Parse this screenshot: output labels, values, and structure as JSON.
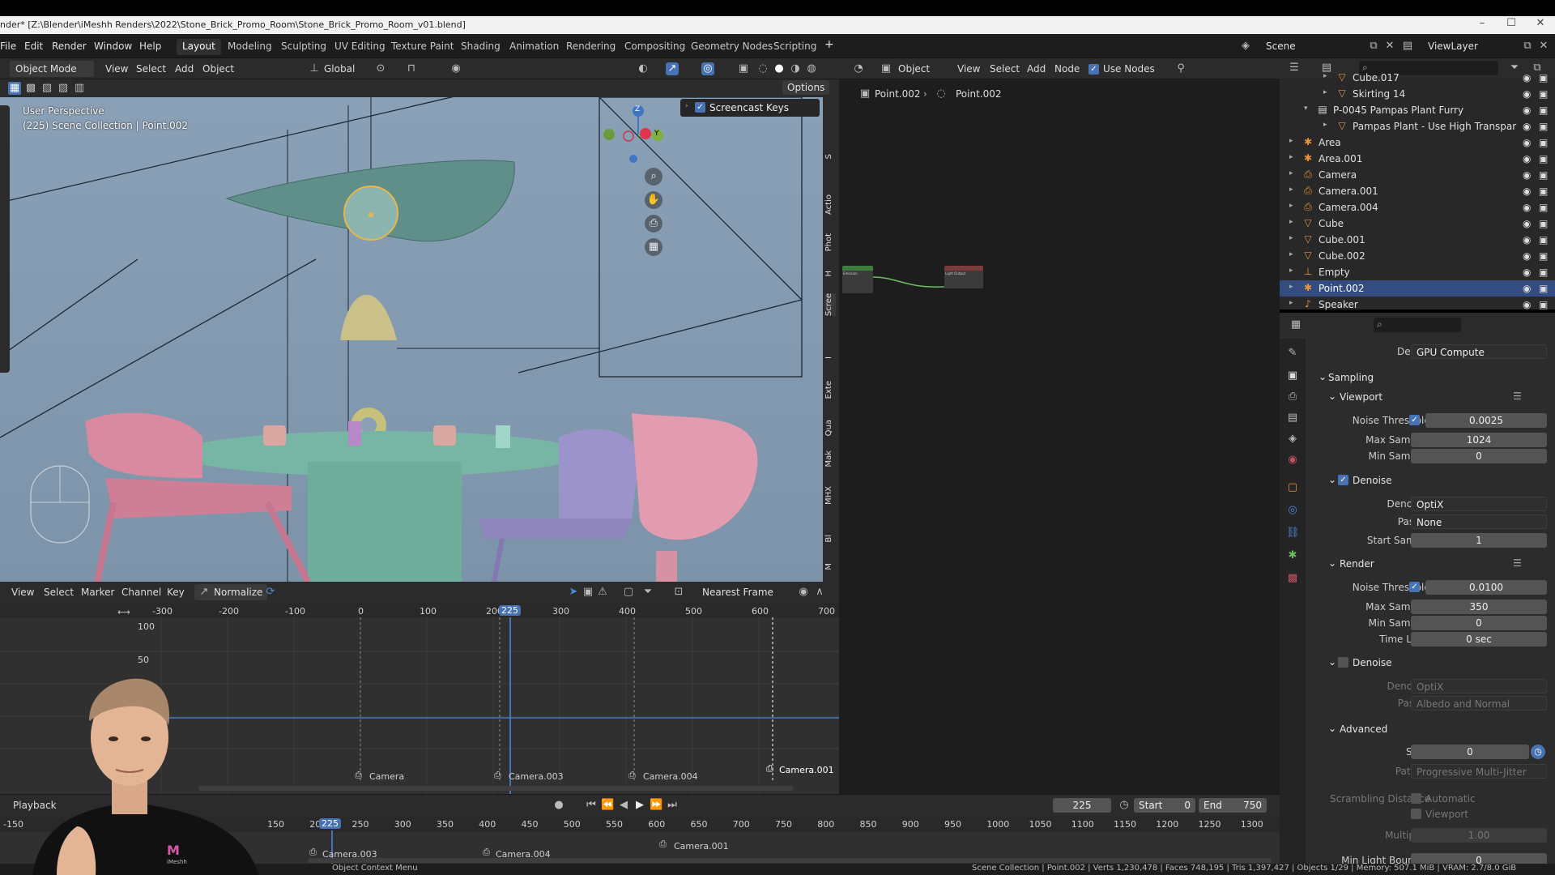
{
  "titlebar": {
    "title": "nder* [Z:\\Blender\\iMeshh Renders\\2022\\Stone_Brick_Promo_Room\\Stone_Brick_Promo_Room_v01.blend]",
    "minimize": "–",
    "maximize": "☐",
    "close": "✕"
  },
  "menu": {
    "items": [
      "File",
      "Edit",
      "Render",
      "Window",
      "Help"
    ],
    "workspaces": [
      "Layout",
      "Modeling",
      "Sculpting",
      "UV Editing",
      "Texture Paint",
      "Shading",
      "Animation",
      "Rendering",
      "Compositing",
      "Geometry Nodes",
      "Scripting"
    ],
    "active_workspace": "Layout",
    "add_tab": "+",
    "scene": "Scene",
    "view_layer": "ViewLayer"
  },
  "viewport_header": {
    "mode": "Object Mode",
    "menus": [
      "View",
      "Select",
      "Add",
      "Object"
    ],
    "orientation": "Global",
    "options": "Options"
  },
  "viewport": {
    "perspective": "User Perspective",
    "collection": "(225) Scene Collection | Point.002",
    "screencast_keys": "Screencast Keys",
    "gizmo_z": "Z",
    "gizmo_y": "Y",
    "n_tabs": [
      "S",
      "Actio",
      "Phot",
      "H",
      "Scree",
      "I",
      "Exte",
      "Qua",
      "Mak",
      "MHX",
      "Bl",
      "M"
    ]
  },
  "node_editor": {
    "type": "Object",
    "menus": [
      "View",
      "Select",
      "Add",
      "Node"
    ],
    "use_nodes": "Use Nodes",
    "breadcrumb_1": "Point.002",
    "breadcrumb_2": "Point.002",
    "node_left_title": "Emission",
    "node_right_title": "Light Output"
  },
  "outliner": {
    "rows": [
      {
        "name": "Cube.017",
        "icon": "mesh-icon",
        "color": "#e0e0e0"
      },
      {
        "name": "Skirting 14",
        "icon": "mesh-icon",
        "color": "#e0e0e0"
      },
      {
        "name": "P-0045 Pampas Plant Furry",
        "icon": "collection-icon",
        "color": "#e0e0e0"
      },
      {
        "name": "Pampas Plant - Use High Transpar",
        "icon": "mesh-icon",
        "color": "#e0e0e0"
      },
      {
        "name": "Area",
        "icon": "light-icon",
        "color": "#e0e0e0"
      },
      {
        "name": "Area.001",
        "icon": "light-icon",
        "color": "#e0e0e0"
      },
      {
        "name": "Camera",
        "icon": "camera-icon",
        "color": "#e0e0e0"
      },
      {
        "name": "Camera.001",
        "icon": "camera-icon",
        "color": "#e0e0e0"
      },
      {
        "name": "Camera.004",
        "icon": "camera-icon",
        "color": "#e0e0e0"
      },
      {
        "name": "Cube",
        "icon": "mesh-icon",
        "color": "#e0e0e0"
      },
      {
        "name": "Cube.001",
        "icon": "mesh-icon",
        "color": "#e0e0e0"
      },
      {
        "name": "Cube.002",
        "icon": "mesh-icon",
        "color": "#e0e0e0"
      },
      {
        "name": "Empty",
        "icon": "empty-icon",
        "color": "#e0e0e0"
      },
      {
        "name": "Point.002",
        "icon": "light-icon",
        "color": "#ffffff",
        "selected": true
      },
      {
        "name": "Speaker",
        "icon": "speaker-icon",
        "color": "#e0e0e0"
      }
    ]
  },
  "properties": {
    "device_label": "Device",
    "device": "GPU Compute",
    "sampling": "Sampling",
    "viewport": {
      "title": "Viewport",
      "noise_threshold_label": "Noise Threshold",
      "noise_threshold": "0.0025",
      "max_samples_label": "Max Samples",
      "max_samples": "1024",
      "min_samples_label": "Min Samples",
      "min_samples": "0"
    },
    "vp_denoise": {
      "title": "Denoise",
      "denoiser_label": "Denoiser",
      "denoiser": "OptiX",
      "passes_label": "Passes",
      "passes": "None",
      "start_sample_label": "Start Sample",
      "start_sample": "1"
    },
    "render": {
      "title": "Render",
      "noise_threshold_label": "Noise Threshold",
      "noise_threshold": "0.0100",
      "max_samples_label": "Max Samples",
      "max_samples": "350",
      "min_samples_label": "Min Samples",
      "min_samples": "0",
      "time_limit_label": "Time Limit",
      "time_limit": "0 sec"
    },
    "r_denoise": {
      "title": "Denoise",
      "denoiser_label": "Denoiser",
      "denoiser": "OptiX",
      "passes_label": "Passes",
      "passes": "Albedo and Normal"
    },
    "advanced": {
      "title": "Advanced",
      "seed_label": "Seed",
      "seed": "0",
      "pattern_label": "Pattern",
      "pattern": "Progressive Multi-Jitter",
      "scrambling_label": "Scrambling Distance",
      "automatic": "Automatic",
      "viewport": "Viewport",
      "multiplier_label": "Multiplier",
      "multiplier": "1.00",
      "min_light_bounces_label": "Min Light Bounces",
      "min_light_bounces": "0"
    }
  },
  "graph_editor": {
    "menus": [
      "View",
      "Select",
      "Marker",
      "Channel",
      "Key"
    ],
    "normalize": "Normalize",
    "snap": "Nearest Frame",
    "frame_ticks": [
      "-300",
      "-200",
      "-100",
      "0",
      "100",
      "200",
      "300",
      "400",
      "500",
      "600",
      "700"
    ],
    "current_frame": "225",
    "y_ticks": [
      "100",
      "50"
    ],
    "markers": [
      "Camera",
      "Camera.003",
      "Camera.004",
      "Camera.001"
    ]
  },
  "timeline": {
    "playback": "Playback",
    "frame": "225",
    "start_label": "Start",
    "start": "0",
    "end_label": "End",
    "end": "750",
    "ticks": [
      "-150",
      "150",
      "200",
      "250",
      "300",
      "350",
      "400",
      "450",
      "500",
      "550",
      "600",
      "650",
      "700",
      "750",
      "800",
      "850",
      "900",
      "950",
      "1000",
      "1050",
      "1100",
      "1150",
      "1200",
      "1250",
      "1300"
    ],
    "current": "225",
    "markers": [
      "Camera.003",
      "Camera.004",
      "Camera.001"
    ]
  },
  "statusbar": {
    "left": "Object Context Menu",
    "right": "Scene Collection | Point.002 | Verts 1,230,478 | Faces 748,195 | Tris 1,397,427 | Objects 1/29 | Memory: 507.1 MiB | VRAM: 2.7/8.0 GiB"
  },
  "webcam": {
    "logo": "iMeshh"
  }
}
